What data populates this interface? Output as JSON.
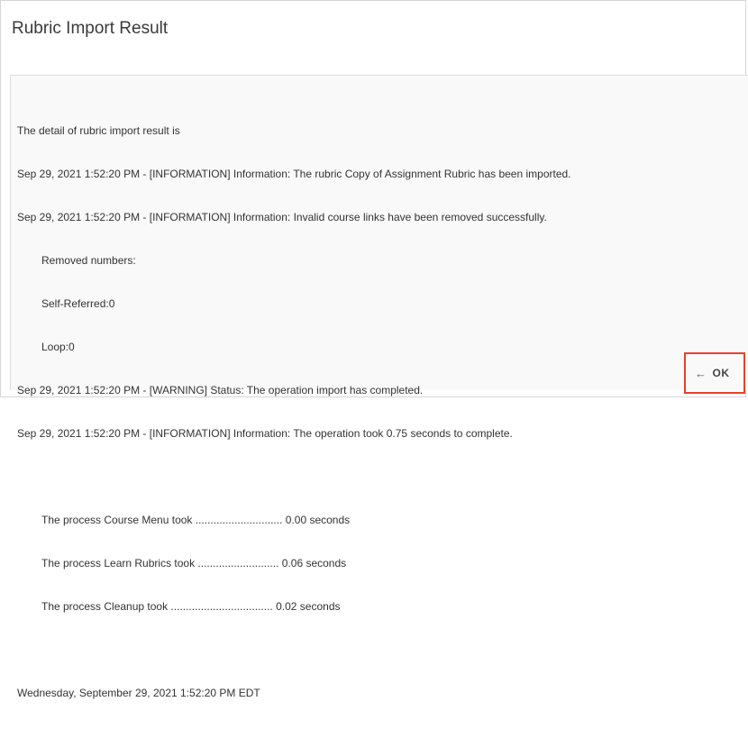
{
  "dialog": {
    "title": "Rubric Import Result"
  },
  "log": {
    "intro": "The detail of rubric import result is",
    "entries": [
      "Sep 29, 2021 1:52:20 PM - [INFORMATION] Information: The rubric Copy of Assignment Rubric has been imported.",
      "Sep 29, 2021 1:52:20 PM - [INFORMATION] Information: Invalid course links have been removed successfully.",
      "Removed numbers:",
      "Self-Referred:0",
      "Loop:0",
      "Sep 29, 2021 1:52:20 PM - [WARNING] Status: The operation import has completed.",
      "Sep 29, 2021 1:52:20 PM - [INFORMATION] Information: The operation took 0.75 seconds to complete."
    ],
    "processes": [
      "The process Course Menu took ............................. 0.00 seconds",
      "The process Learn Rubrics took ........................... 0.06 seconds",
      "The process Cleanup took .................................. 0.02 seconds"
    ],
    "timestamp": "Wednesday, September 29, 2021 1:52:20 PM EDT"
  },
  "footer": {
    "ok_label": "OK",
    "ok_icon": "arrow-left-icon",
    "ok_arrow_glyph": "←",
    "highlight_color": "#e8412c"
  }
}
